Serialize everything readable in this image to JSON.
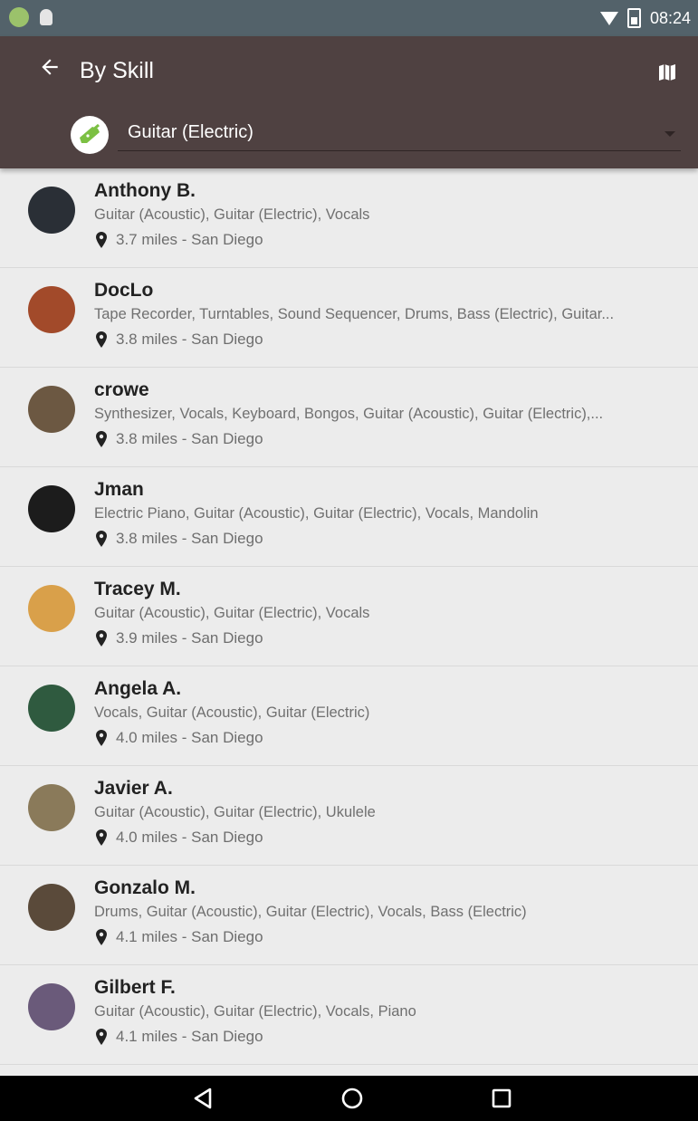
{
  "status_bar": {
    "time": "08:24"
  },
  "app_bar": {
    "title": "By Skill"
  },
  "skill_filter": {
    "selected": "Guitar (Electric)"
  },
  "people": [
    {
      "name": "Anthony B.",
      "skills": "Guitar (Acoustic), Guitar (Electric), Vocals",
      "location": "3.7 miles - San Diego",
      "avatar_color": "#2a2f36"
    },
    {
      "name": "DocLo",
      "skills": "Tape Recorder, Turntables, Sound Sequencer, Drums, Bass (Electric), Guitar...",
      "location": "3.8 miles - San Diego",
      "avatar_color": "#a24a2a"
    },
    {
      "name": "crowe",
      "skills": "Synthesizer, Vocals, Keyboard, Bongos, Guitar (Acoustic), Guitar (Electric),...",
      "location": "3.8 miles - San Diego",
      "avatar_color": "#6c5842"
    },
    {
      "name": "Jman",
      "skills": "Electric Piano, Guitar (Acoustic), Guitar (Electric), Vocals, Mandolin",
      "location": "3.8 miles - San Diego",
      "avatar_color": "#1c1c1c"
    },
    {
      "name": "Tracey M.",
      "skills": "Guitar (Acoustic), Guitar (Electric), Vocals",
      "location": "3.9 miles - San Diego",
      "avatar_color": "#d9a04a"
    },
    {
      "name": "Angela A.",
      "skills": "Vocals, Guitar (Acoustic), Guitar (Electric)",
      "location": "4.0 miles - San Diego",
      "avatar_color": "#2f5a3f"
    },
    {
      "name": "Javier A.",
      "skills": "Guitar (Acoustic), Guitar (Electric), Ukulele",
      "location": "4.0 miles - San Diego",
      "avatar_color": "#8a7a5a"
    },
    {
      "name": "Gonzalo M.",
      "skills": "Drums, Guitar (Acoustic), Guitar (Electric), Vocals, Bass (Electric)",
      "location": "4.1 miles - San Diego",
      "avatar_color": "#5a4a3a"
    },
    {
      "name": "Gilbert F.",
      "skills": "Guitar (Acoustic), Guitar (Electric), Vocals, Piano",
      "location": "4.1 miles - San Diego",
      "avatar_color": "#6a5a7a"
    }
  ],
  "icons": {
    "back": "arrow-back-icon",
    "map": "map-icon",
    "skill": "guitar-icon",
    "location": "location-pin-icon",
    "nav_back": "triangle-back-icon",
    "nav_home": "circle-home-icon",
    "nav_recents": "square-recents-icon"
  },
  "colors": {
    "app_bar": "#4f4141",
    "status_bar": "#53626a",
    "list_bg": "#ececec",
    "skill_icon": "#7cc043"
  }
}
